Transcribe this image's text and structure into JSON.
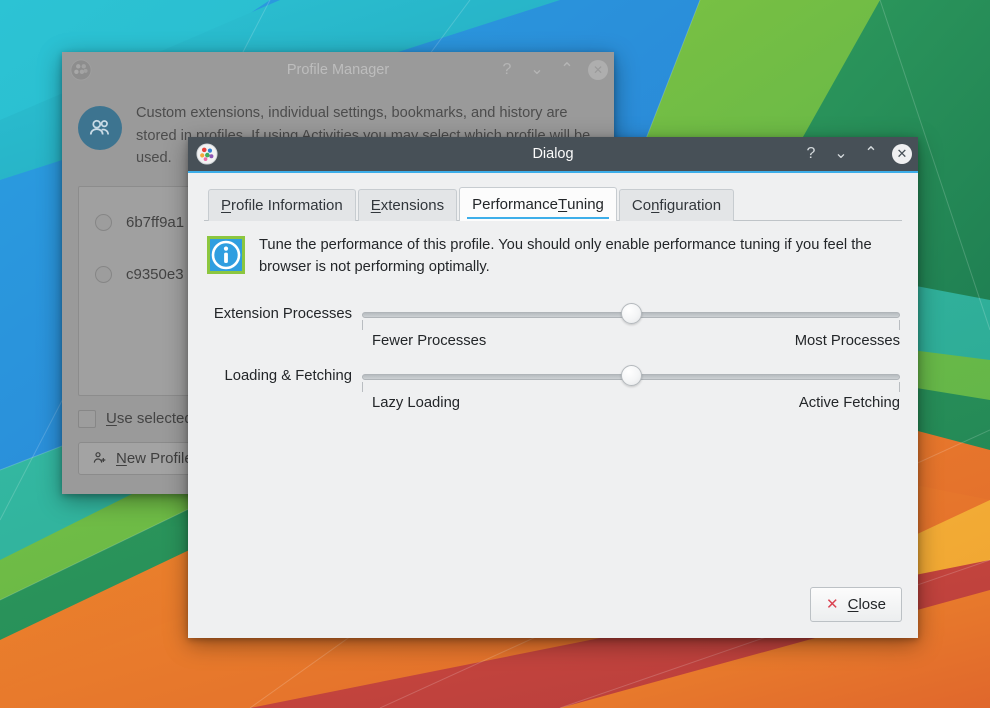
{
  "desktop": {
    "wallpaper_name": "geometric-polygon-wallpaper"
  },
  "profile_manager": {
    "title": "Profile Manager",
    "intro": "Custom extensions, individual settings, bookmarks, and history are stored in profiles. If using Activities you may select which profile will be used.",
    "profiles": [
      {
        "id": "6b7ff9a1",
        "selected": false
      },
      {
        "id": "c9350e3",
        "selected": false
      }
    ],
    "use_selected_checkbox": {
      "label": "Use selected profile on next start",
      "checked": false
    },
    "new_profile_button": "New Profile",
    "titlebar_buttons": [
      {
        "name": "help",
        "glyph": "?"
      },
      {
        "name": "shade",
        "glyph": "⌄"
      },
      {
        "name": "maximize",
        "glyph": "⌃"
      },
      {
        "name": "close",
        "glyph": "✕"
      }
    ]
  },
  "dialog": {
    "title": "Dialog",
    "app_icon": "falkon-icon",
    "titlebar_buttons": [
      {
        "name": "help",
        "glyph": "?"
      },
      {
        "name": "shade",
        "glyph": "⌄"
      },
      {
        "name": "maximize",
        "glyph": "⌃"
      },
      {
        "name": "close",
        "glyph": "✕"
      }
    ],
    "tabs": [
      {
        "label": "Profile Information",
        "mnemonic": "P",
        "active": false
      },
      {
        "label": "Extensions",
        "mnemonic": "E",
        "active": false
      },
      {
        "label": "Performance Tuning",
        "mnemonic": "T",
        "active": true
      },
      {
        "label": "Configuration",
        "mnemonic": "n",
        "active": false
      }
    ],
    "performance_tuning": {
      "info_icon": "info-icon",
      "info_text": "Tune the performance of this profile. You should only enable performance tuning if you feel the browser is not performing optimally.",
      "sliders": [
        {
          "label": "Extension Processes",
          "min_label": "Fewer Processes",
          "max_label": "Most Processes",
          "value_percent": 50
        },
        {
          "label": "Loading & Fetching",
          "min_label": "Lazy Loading",
          "max_label": "Active Fetching",
          "value_percent": 50
        }
      ]
    },
    "close_button": {
      "label": "Close",
      "mnemonic": "C",
      "icon": "red-x-icon"
    },
    "accent_color": "#3daee9",
    "titlebar_color": "#475057",
    "background_color": "#eff0f1"
  }
}
